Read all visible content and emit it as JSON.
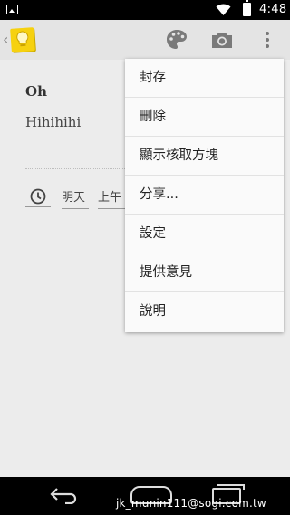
{
  "status_bar": {
    "time": "4:48",
    "icons": [
      "image-icon",
      "wifi-icon",
      "battery-icon"
    ]
  },
  "action_bar": {
    "back_glyph": "‹",
    "app_icon": "keep-bulb-icon",
    "actions": [
      "palette-icon",
      "camera-icon",
      "overflow-menu-icon"
    ],
    "app_icon_color": "#f6d10f"
  },
  "note": {
    "title": "Oh",
    "body": "Hihihihi",
    "reminder": {
      "icon": "clock-icon",
      "day": "明天",
      "time": "上午"
    }
  },
  "menu": {
    "items": [
      {
        "label": "封存"
      },
      {
        "label": "刪除"
      },
      {
        "label": "顯示核取方塊"
      },
      {
        "label": "分享..."
      },
      {
        "label": "設定"
      },
      {
        "label": "提供意見"
      },
      {
        "label": "說明"
      }
    ]
  },
  "nav_bar": {
    "buttons": [
      "back-icon",
      "home-icon",
      "recent-apps-icon"
    ]
  },
  "watermark": "jk_munin111@sogi.com.tw"
}
